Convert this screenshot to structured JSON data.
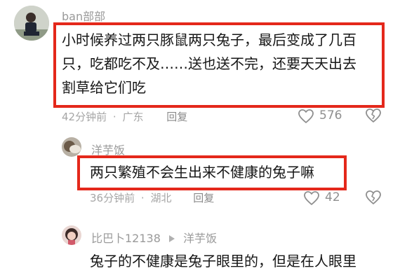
{
  "comments": [
    {
      "username": "ban部部",
      "text": "小时候养过两只豚鼠两只兔子，最后变成了几百只，吃都吃不及……送也送不完，还要天天出去割草给它们吃",
      "lines": [
        "小时候养过两只豚鼠两只兔子，最后变成了几百",
        "只，吃都吃不及……送也送不完，还要天天出去",
        "割草给它们吃"
      ],
      "time": "42分钟前",
      "location": "广东",
      "reply_label": "回复",
      "like_count": "576"
    },
    {
      "username": "洋芋饭",
      "text": "两只繁殖不会生出来不健康的兔子嘛",
      "time": "36分钟前",
      "location": "湖北",
      "reply_label": "回复",
      "like_count": "42"
    },
    {
      "username": "比巴卜12138",
      "reply_to": "洋芋饭",
      "text_line1": "兔子的不健康是兔子眼里的，但是在人眼里"
    }
  ],
  "separator": "·",
  "colors": {
    "highlight": "#e4281b",
    "meta": "#a6a6a6"
  },
  "icons": {
    "like": "heart-icon",
    "dislike": "broken-heart-icon",
    "reply_arrow": "triangle-right-icon"
  }
}
